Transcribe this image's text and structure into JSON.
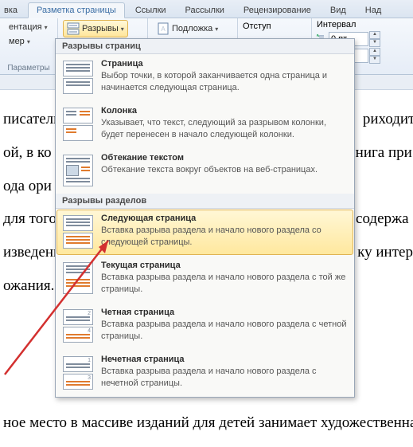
{
  "tabs": {
    "t0": "вка",
    "t1": "Разметка страницы",
    "t2": "Ссылки",
    "t3": "Рассылки",
    "t4": "Рецензирование",
    "t5": "Вид",
    "t6": "Над"
  },
  "ribbon": {
    "orient": "ентация",
    "size": "мер",
    "breaks": "Разрывы",
    "params_label": "Параметры",
    "watermark": "Подложка",
    "indent": "Отступ",
    "spacing": "Интервал",
    "spacing_before": "0 пт",
    "spacing_after": "0 пт"
  },
  "dropdown": {
    "hdr_page": "Разрывы страниц",
    "hdr_section": "Разрывы разделов",
    "items": {
      "page": {
        "title": "Страница",
        "desc": "Выбор точки, в которой заканчивается одна страница и начинается следующая страница."
      },
      "column": {
        "title": "Колонка",
        "desc": "Указывает, что текст, следующий за разрывом колонки, будет перенесен в начало следующей колонки."
      },
      "wrap": {
        "title": "Обтекание текстом",
        "desc": "Обтекание текста вокруг объектов на веб-страницах."
      },
      "next": {
        "title": "Следующая страница",
        "desc": "Вставка разрыва раздела и начало нового раздела со следующей страницы."
      },
      "cont": {
        "title": "Текущая страница",
        "desc": "Вставка разрыва раздела и начало нового раздела с той же страницы."
      },
      "even": {
        "title": "Четная страница",
        "desc": "Вставка разрыва раздела и начало нового раздела с четной страницы."
      },
      "odd": {
        "title": "Нечетная страница",
        "desc": "Вставка разрыва раздела и начало нового раздела с нечетной страницы."
      }
    }
  },
  "document": {
    "l1": "писатель",
    "l1b": "риходит",
    "l2": "ой, в ко",
    "l2b": "нига при",
    "l3": "ода ори",
    "l4": "для того",
    "l4b": "содержа",
    "l5": "изведени",
    "l5b": "ку интер",
    "l6": "ожания.",
    "l7": "ное место в массиве изданий для детей занимает художественна"
  }
}
